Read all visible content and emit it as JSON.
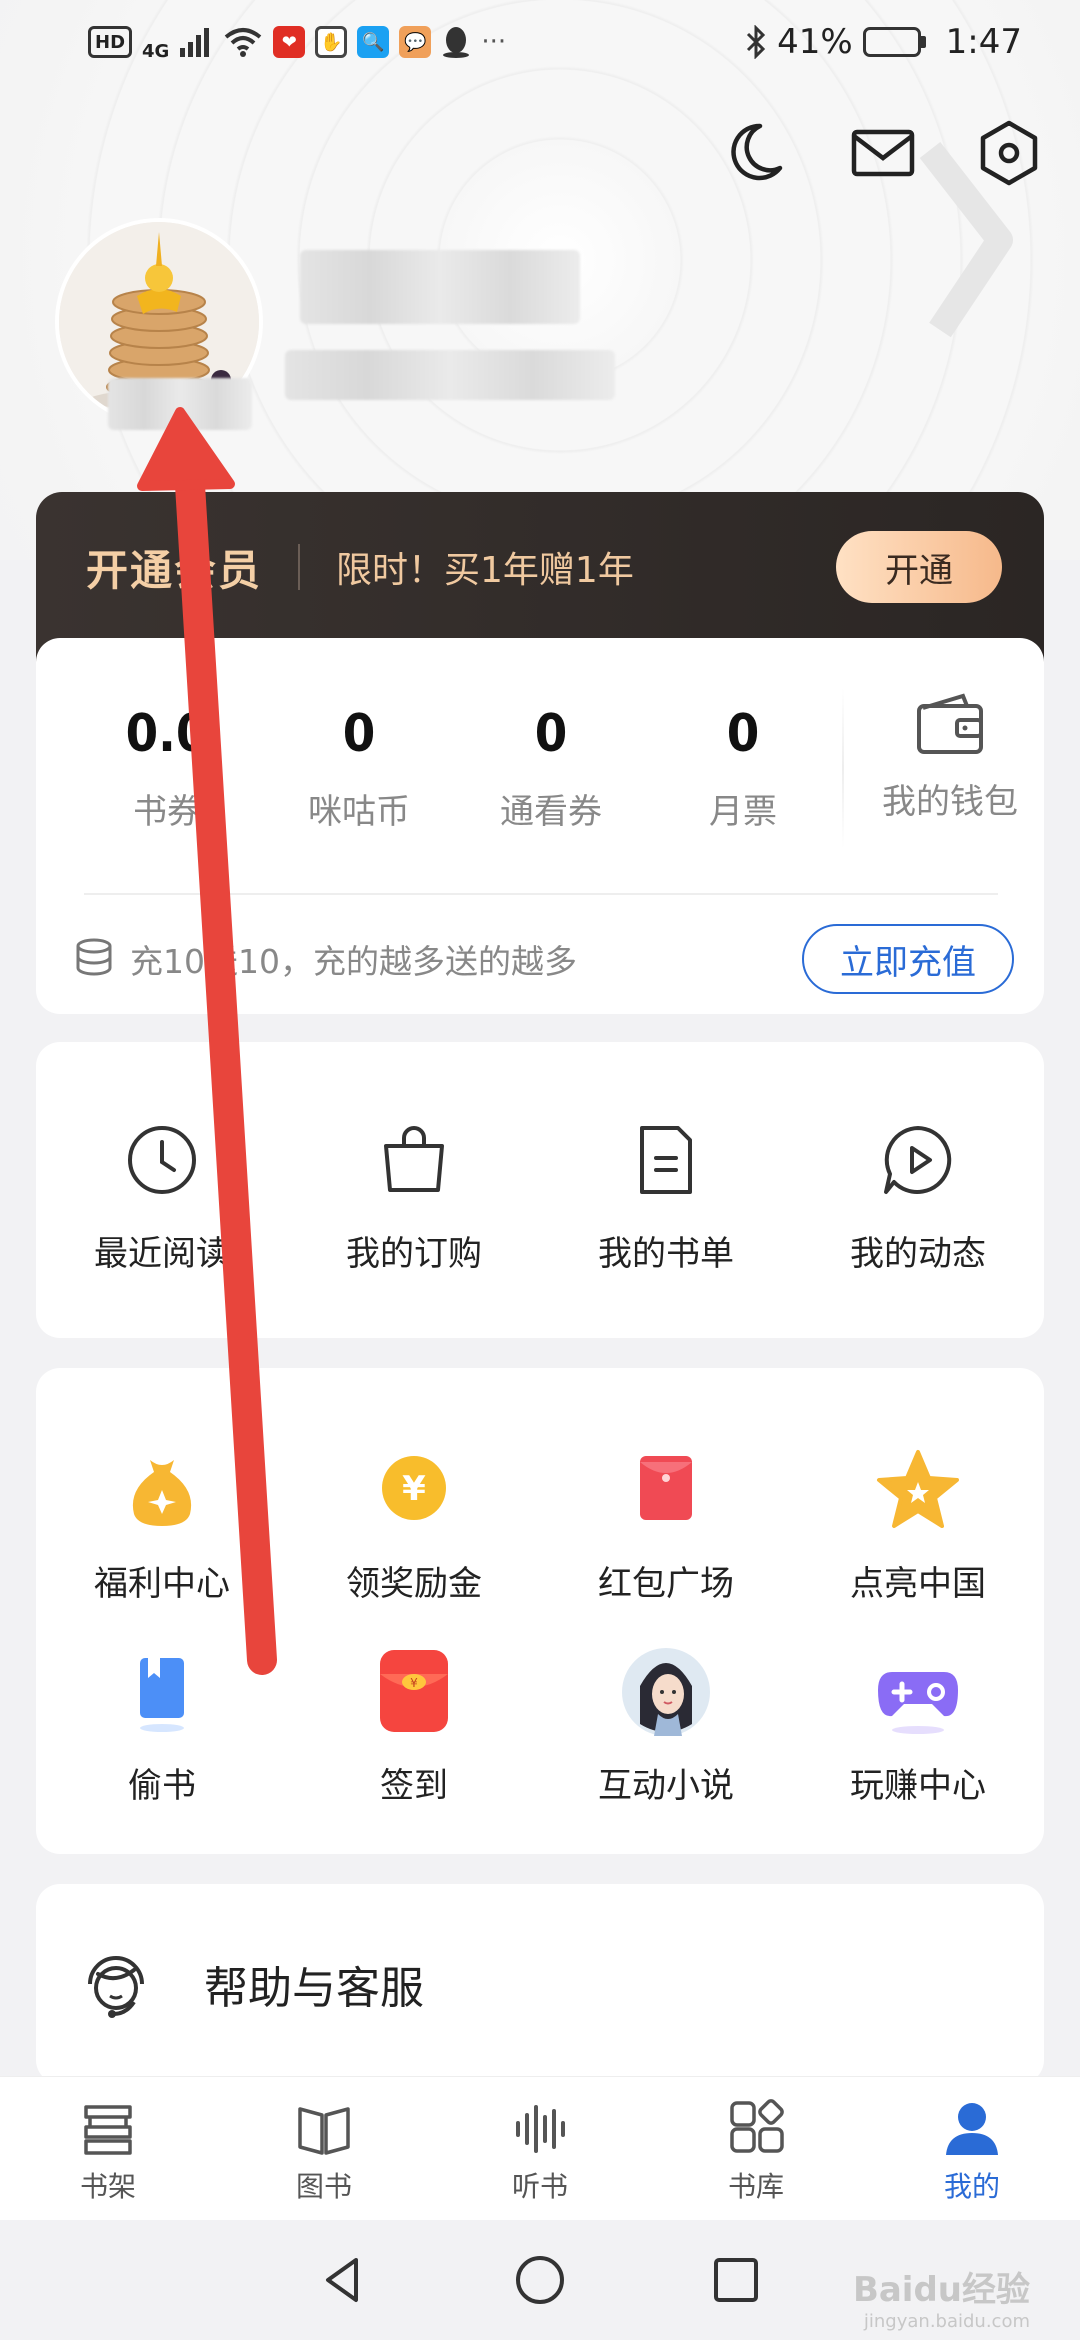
{
  "status_bar": {
    "hd": "HD",
    "network": "4G",
    "battery_percent": "41%",
    "battery_level": 0.41,
    "time": "1:47",
    "app_badges": [
      {
        "name": "pinduoduo",
        "color": "#e02e24"
      },
      {
        "name": "hand-app",
        "color": "#555555"
      },
      {
        "name": "search-app",
        "color": "#1ba1f2"
      },
      {
        "name": "chat-app",
        "color": "#f0a05a"
      }
    ]
  },
  "top_bar": {
    "icons": [
      "moon-icon",
      "mail-icon",
      "settings-hexagon-icon"
    ]
  },
  "vip": {
    "title": "开通会员",
    "promo": "限时！买1年赠1年",
    "button": "开通"
  },
  "wallet": {
    "stats": [
      {
        "value": "0.0",
        "label": "书券"
      },
      {
        "value": "0",
        "label": "咪咕币"
      },
      {
        "value": "0",
        "label": "通看券"
      },
      {
        "value": "0",
        "label": "月票"
      }
    ],
    "wallet_label": "我的钱包",
    "recharge_text": "充10送10，充的越多送的越多",
    "recharge_button": "立即充值"
  },
  "quick_actions": [
    {
      "label": "最近阅读",
      "icon": "clock-icon"
    },
    {
      "label": "我的订购",
      "icon": "shopping-bag-icon"
    },
    {
      "label": "我的书单",
      "icon": "document-icon"
    },
    {
      "label": "我的动态",
      "icon": "play-bubble-icon"
    }
  ],
  "features": [
    {
      "label": "福利中心",
      "icon": "money-bag-icon"
    },
    {
      "label": "领奖励金",
      "icon": "yuan-coin-icon"
    },
    {
      "label": "红包广场",
      "icon": "red-envelope-icon"
    },
    {
      "label": "点亮中国",
      "icon": "star-icon"
    },
    {
      "label": "偷书",
      "icon": "blue-book-icon"
    },
    {
      "label": "签到",
      "icon": "checkin-envelope-icon"
    },
    {
      "label": "互动小说",
      "icon": "character-avatar-icon"
    },
    {
      "label": "玩赚中心",
      "icon": "gamepad-icon"
    }
  ],
  "help": {
    "label": "帮助与客服"
  },
  "bottom_nav": [
    {
      "label": "书架",
      "icon": "bookshelf-icon",
      "active": false
    },
    {
      "label": "图书",
      "icon": "open-book-icon",
      "active": false
    },
    {
      "label": "听书",
      "icon": "soundwave-icon",
      "active": false
    },
    {
      "label": "书库",
      "icon": "apps-grid-icon",
      "active": false
    },
    {
      "label": "我的",
      "icon": "user-icon",
      "active": true
    }
  ],
  "watermark": {
    "brand": "Baidu经验",
    "url": "jingyan.baidu.com"
  },
  "colors": {
    "accent_blue": "#2a6bd6",
    "vip_gold": "#f4cfa6",
    "annotation_red": "#e8453c"
  }
}
